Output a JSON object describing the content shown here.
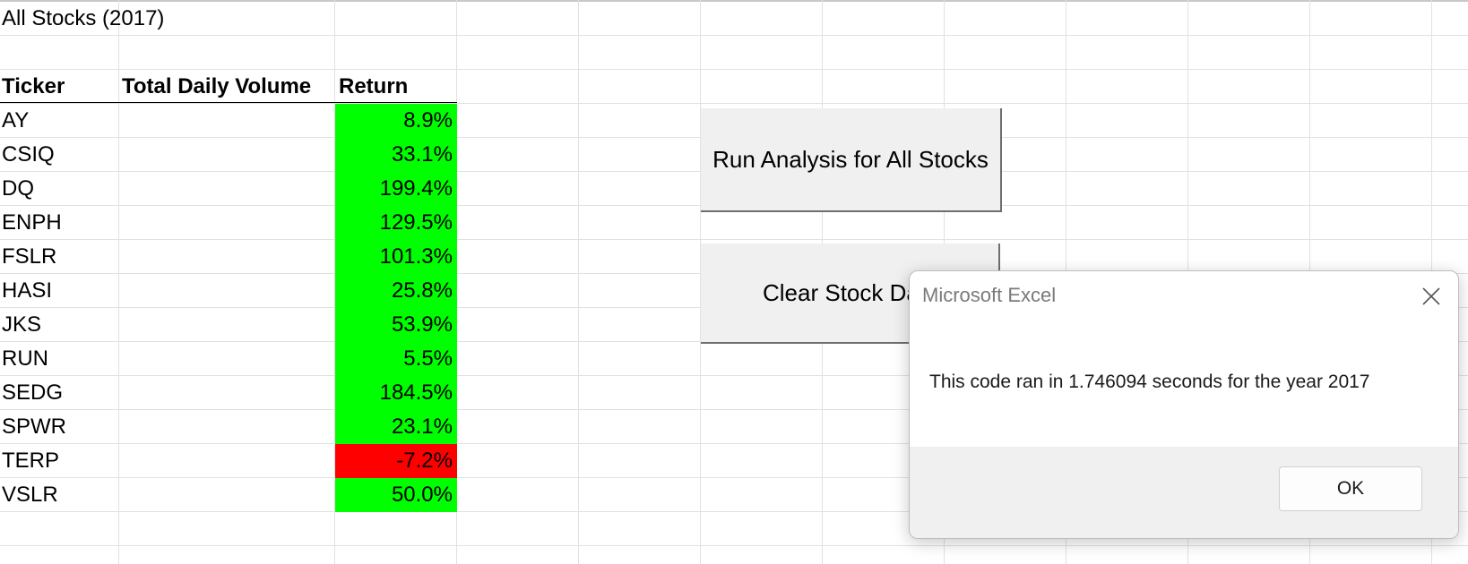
{
  "sheet": {
    "title": "All Stocks (2017)",
    "headers": {
      "ticker": "Ticker",
      "volume": "Total Daily Volume",
      "return": "Return"
    },
    "rows": [
      {
        "ticker": "AY",
        "volume": "",
        "return": "8.9%",
        "positive": true
      },
      {
        "ticker": "CSIQ",
        "volume": "",
        "return": "33.1%",
        "positive": true
      },
      {
        "ticker": "DQ",
        "volume": "",
        "return": "199.4%",
        "positive": true
      },
      {
        "ticker": "ENPH",
        "volume": "",
        "return": "129.5%",
        "positive": true
      },
      {
        "ticker": "FSLR",
        "volume": "",
        "return": "101.3%",
        "positive": true
      },
      {
        "ticker": "HASI",
        "volume": "",
        "return": "25.8%",
        "positive": true
      },
      {
        "ticker": "JKS",
        "volume": "",
        "return": "53.9%",
        "positive": true
      },
      {
        "ticker": "RUN",
        "volume": "",
        "return": "5.5%",
        "positive": true
      },
      {
        "ticker": "SEDG",
        "volume": "",
        "return": "184.5%",
        "positive": true
      },
      {
        "ticker": "SPWR",
        "volume": "",
        "return": "23.1%",
        "positive": true
      },
      {
        "ticker": "TERP",
        "volume": "",
        "return": "-7.2%",
        "positive": false
      },
      {
        "ticker": "VSLR",
        "volume": "",
        "return": "50.0%",
        "positive": true
      }
    ]
  },
  "buttons": {
    "run_analysis": "Run Analysis for All Stocks",
    "clear_data": "Clear Stock Data"
  },
  "dialog": {
    "title": "Microsoft Excel",
    "message": "This code ran in 1.746094 seconds for the year 2017",
    "ok_label": "OK",
    "close_icon": "close-icon"
  },
  "colors": {
    "positive_fill": "#00ff00",
    "negative_fill": "#ff0000",
    "gridline": "#e1e1e1",
    "button_face": "#f0f0f0"
  }
}
